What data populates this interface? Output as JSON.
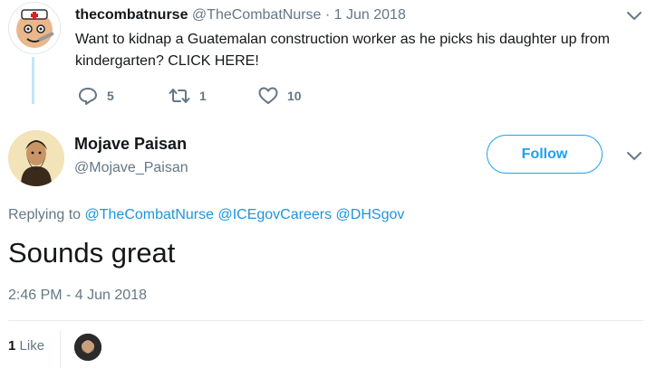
{
  "parent_tweet": {
    "display_name": "thecombatnurse",
    "meta": "@TheCombatNurse · 1 Jun 2018",
    "text": "Want to kidnap a Guatemalan construction worker as he picks his daughter up from kindergarten? CLICK HERE!",
    "replies": "5",
    "retweets": "1",
    "likes": "10"
  },
  "main_tweet": {
    "display_name": "Mojave Paisan",
    "handle": "@Mojave_Paisan",
    "follow_label": "Follow",
    "replying_prefix": "Replying to",
    "mentions": [
      "@TheCombatNurse",
      "@ICEgovCareers",
      "@DHSgov"
    ],
    "text": "Sounds great",
    "timestamp": "2:46 PM - 4 Jun 2018",
    "like_count": "1",
    "like_label": "Like"
  },
  "colors": {
    "accent": "#1da1f2",
    "link": "#1b95e0",
    "muted": "#657786",
    "thread_line": "#c4e6f5"
  },
  "icons": [
    "reply-icon",
    "retweet-icon",
    "heart-icon",
    "chevron-down-icon"
  ]
}
